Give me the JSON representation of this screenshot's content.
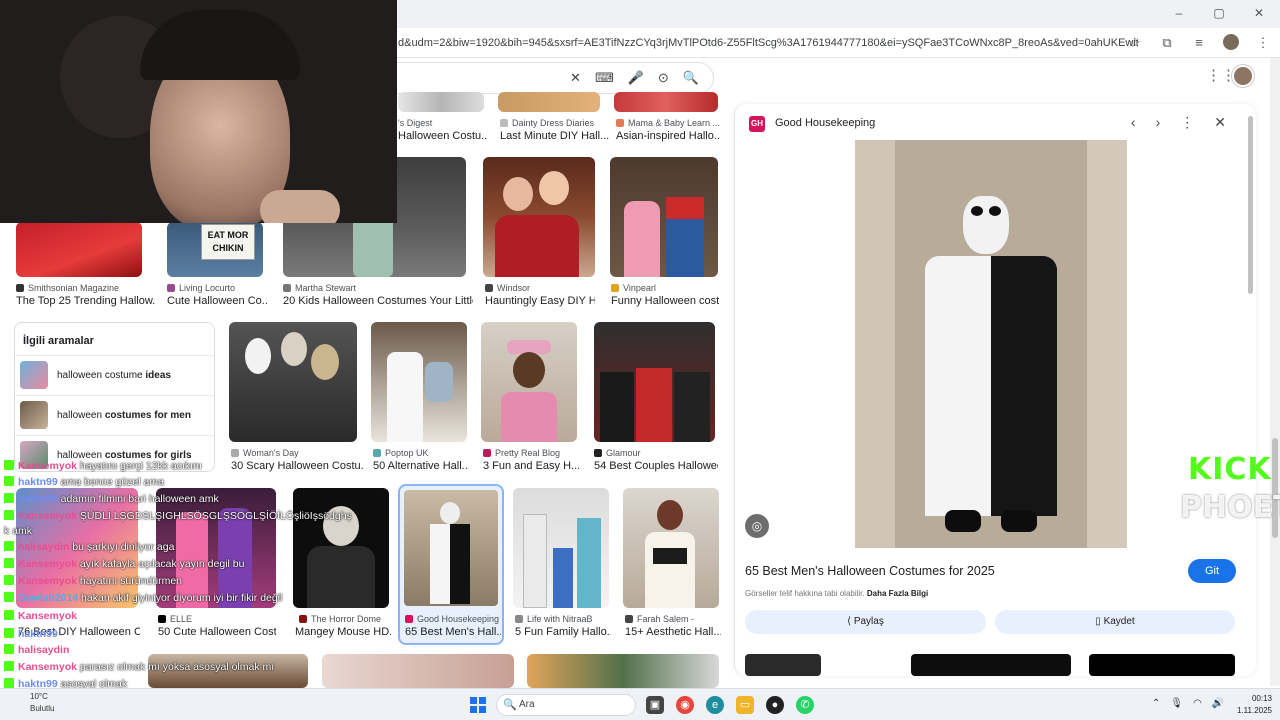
{
  "browser": {
    "url": "d&udm=2&biw=1920&bih=945&sxsrf=AE3TifNzzCYq3rjMvTlPOtd6-Z55FltScg%3A1761944777180&ei=ySQFae3TCoWNxc8P_8reoAs&ved=0ahUKEwit3Lrkq8-QAxWFRVEDHX-IF...",
    "window_controls": [
      "–",
      "▢",
      "✕"
    ]
  },
  "search": {
    "tools": [
      "✕",
      "⌨",
      "🎤",
      "⊙",
      "🔍"
    ]
  },
  "grid": {
    "row1": [
      {
        "source": "'s Digest",
        "title": "Halloween Costu..."
      },
      {
        "source": "Dainty Dress Diaries",
        "title": "Last Minute DIY Hall..."
      },
      {
        "source": "Mama & Baby Learn ...",
        "title": "Asian-inspired Hallo..."
      }
    ],
    "row2": [
      {
        "source": "Smithsonian Magazine",
        "title": "The Top 25 Trending Hallow..."
      },
      {
        "source": "Living Locurto",
        "title": "Cute Halloween Co..."
      },
      {
        "source": "Martha Stewart",
        "title": "20 Kids Halloween Costumes Your Little ..."
      },
      {
        "source": "Windsor",
        "title": "Hauntingly Easy DIY H..."
      },
      {
        "source": "Vinpearl",
        "title": "Funny Halloween cost..."
      }
    ],
    "row3": [
      {
        "source": "Woman's Day",
        "title": "30 Scary Halloween Costu..."
      },
      {
        "source": "Poptop UK",
        "title": "50 Alternative Hall..."
      },
      {
        "source": "Pretty Real Blog",
        "title": "3 Fun and Easy H..."
      },
      {
        "source": "Glamour",
        "title": "54 Best Couples Halloween..."
      }
    ],
    "row4": [
      {
        "source": "",
        "title": "76 Best DIY Halloween C..."
      },
      {
        "source": "ELLE",
        "title": "50 Cute Halloween Costu..."
      },
      {
        "source": "The Horror Dome",
        "title": "Mangey Mouse HD..."
      },
      {
        "source": "Good Housekeeping",
        "title": "65 Best Men's Hall..."
      },
      {
        "source": "Life with NitraaB",
        "title": "5 Fun Family Hallo..."
      },
      {
        "source": "Farah Salem -",
        "title": "15+ Aesthetic Hall..."
      }
    ],
    "sign_text": "EAT MOR CHIKIN"
  },
  "related": {
    "title": "İlgili aramalar",
    "items": [
      {
        "prefix": "halloween costume ",
        "bold": "ideas"
      },
      {
        "prefix": "halloween ",
        "bold": "costumes for men"
      },
      {
        "prefix": "halloween ",
        "bold": "costumes for girls"
      }
    ]
  },
  "preview": {
    "logo": "GH",
    "source": "Good Housekeeping",
    "title": "65 Best Men's Halloween Costumes for 2025",
    "go_label": "Git",
    "note_prefix": "Görseller telif hakkına tabi olabilir.",
    "note_link": "Daha Fazla Bilgi",
    "share_label": "Paylaş",
    "save_label": "Kaydet"
  },
  "chat": [
    {
      "user": "Kansemyok",
      "msg": "hayatını gerçi 12kk acıkını",
      "color": "#e94e8f"
    },
    {
      "user": "haktn99",
      "msg": "ama bence güzel ama",
      "color": "#6b8cf5"
    },
    {
      "user": "haktn99",
      "msg": "adamın filmini bari halloween amk",
      "color": "#6b8cf5"
    },
    {
      "user": "Kansemyok",
      "msg": "ŞÜDLİ LŞGDSLŞIGHLSÖSGLŞSÖGLŞİÖİLÖşliöIşsödghş",
      "color": "#e94e8f"
    },
    {
      "user": "",
      "msg": "k amk",
      "color": "#ffffff"
    },
    {
      "user": "halisaydin",
      "msg": "bu şarkıyı dinliyor aga",
      "color": "#e94e8f"
    },
    {
      "user": "Kansemyok",
      "msg": "ayık kafayla açılacak yayın degil bu",
      "color": "#e94e8f"
    },
    {
      "user": "Kansemyok",
      "msg": "hayatını süründürmen",
      "color": "#e94e8f"
    },
    {
      "user": "Dawlah2014",
      "msg": "hakan akif giyiniyor diyorum iyi bir fikir değil",
      "color": "#5aa7e6"
    },
    {
      "user": "Kansemyok",
      "msg": "",
      "color": "#e94e8f"
    },
    {
      "user": "haktn99",
      "msg": "",
      "color": "#6b8cf5"
    },
    {
      "user": "halisaydin",
      "msg": "",
      "color": "#e94e8f"
    },
    {
      "user": "Kansemyok",
      "msg": "parasız olmak mı yoksa asosyal olmak mı",
      "color": "#e94e8f"
    },
    {
      "user": "haktn99",
      "msg": "asosyal olmak",
      "color": "#6b8cf5"
    },
    {
      "user": "haktn99",
      "msg": "",
      "color": "#6b8cf5"
    }
  ],
  "stream": {
    "logo_text": "KICK",
    "sub_text": "PHOETA"
  },
  "taskbar": {
    "weather_temp": "10°C",
    "weather_desc": "Bulutlu",
    "search_placeholder": "Ara",
    "time": "00:13",
    "date": "1.11.2025"
  },
  "colors": {
    "accent": "#1a73e8",
    "kick": "#53fc18",
    "gh": "#d6135b"
  }
}
